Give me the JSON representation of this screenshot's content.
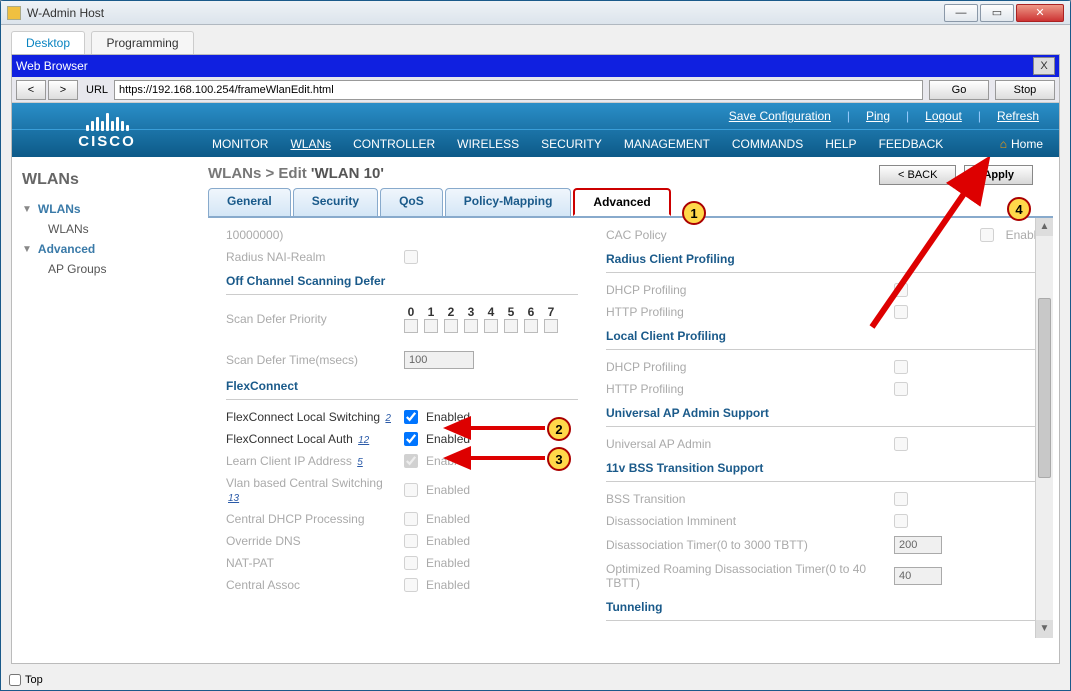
{
  "window": {
    "title": "W-Admin Host"
  },
  "outer_tabs": {
    "desktop": "Desktop",
    "programming": "Programming"
  },
  "browser": {
    "label": "Web Browser",
    "url_label": "URL",
    "url": "https://192.168.100.254/frameWlanEdit.html",
    "go": "Go",
    "stop": "Stop",
    "back": "<",
    "fwd": ">"
  },
  "header": {
    "links": {
      "save": "Save Configuration",
      "ping": "Ping",
      "logout": "Logout",
      "refresh": "Refresh"
    },
    "nav": [
      "MONITOR",
      "WLANs",
      "CONTROLLER",
      "WIRELESS",
      "SECURITY",
      "MANAGEMENT",
      "COMMANDS",
      "HELP",
      "FEEDBACK"
    ],
    "home": "Home",
    "brand": "CISCO"
  },
  "sidebar": {
    "title": "WLANs",
    "items": [
      {
        "label": "WLANs",
        "expandable": true
      },
      {
        "label": "WLANs",
        "sub": true
      },
      {
        "label": "Advanced",
        "expandable": true
      },
      {
        "label": "AP Groups",
        "sub": true
      }
    ]
  },
  "page": {
    "breadcrumb_a": "WLANs > Edit  ",
    "breadcrumb_b": "'WLAN 10'",
    "back": "< BACK",
    "apply": "Apply",
    "tabs": [
      "General",
      "Security",
      "QoS",
      "Policy-Mapping",
      "Advanced"
    ],
    "left": {
      "hint": "10000000)",
      "nai": "Radius NAI-Realm",
      "sec_off": "Off Channel Scanning Defer",
      "scan_prio": "Scan Defer Priority",
      "nums": [
        "0",
        "1",
        "2",
        "3",
        "4",
        "5",
        "6",
        "7"
      ],
      "scan_time": "Scan Defer Time(msecs)",
      "scan_time_val": "100",
      "sec_flex": "FlexConnect",
      "rows": [
        {
          "label": "FlexConnect Local Switching",
          "fn": "2",
          "checked": true,
          "enabled": "Enabled",
          "active": true
        },
        {
          "label": "FlexConnect Local Auth",
          "fn": "12",
          "checked": true,
          "enabled": "Enabled",
          "active": true
        },
        {
          "label": "Learn Client IP Address",
          "fn": "5",
          "checked": true,
          "enabled": "Enabled"
        },
        {
          "label": "Vlan based Central Switching",
          "fn": "13",
          "checked": false,
          "enabled": "Enabled"
        },
        {
          "label": "Central DHCP Processing",
          "checked": false,
          "enabled": "Enabled"
        },
        {
          "label": "Override DNS",
          "checked": false,
          "enabled": "Enabled"
        },
        {
          "label": "NAT-PAT",
          "checked": false,
          "enabled": "Enabled"
        },
        {
          "label": "Central Assoc",
          "checked": false,
          "enabled": "Enabled"
        }
      ]
    },
    "right": {
      "cac": "CAC Policy",
      "enable": "Enable",
      "sec_radius": "Radius Client Profiling",
      "dhcp": "DHCP Profiling",
      "http": "HTTP Profiling",
      "sec_local": "Local Client Profiling",
      "sec_uap": "Universal AP Admin Support",
      "uap": "Universal AP Admin",
      "sec_11v": "11v BSS Transition Support",
      "bss": "BSS Transition",
      "dimm": "Disassociation Imminent",
      "dtimer": "Disassociation Timer(0 to 3000 TBTT)",
      "dtimer_val": "200",
      "rtimer": "Optimized Roaming Disassociation Timer(0 to 40 TBTT)",
      "rtimer_val": "40",
      "sec_tun": "Tunneling"
    }
  },
  "footer": {
    "top": "Top"
  }
}
